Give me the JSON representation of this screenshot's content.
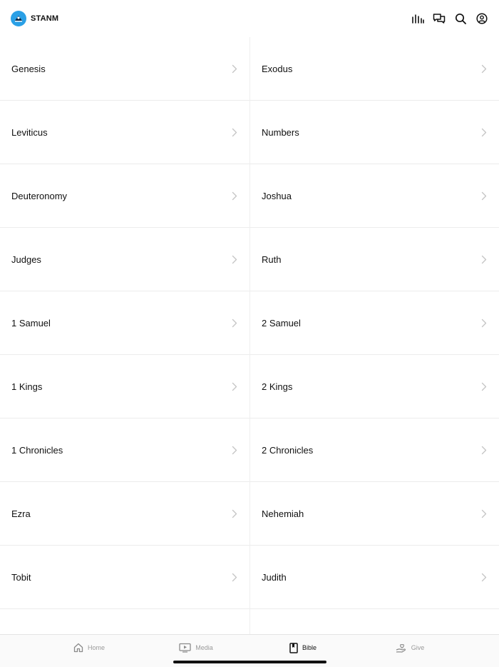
{
  "header": {
    "brand_name": "STANM",
    "actions": [
      {
        "name": "stats-icon"
      },
      {
        "name": "chat-icon"
      },
      {
        "name": "search-icon"
      },
      {
        "name": "profile-icon"
      }
    ]
  },
  "books": [
    [
      "Genesis",
      "Exodus"
    ],
    [
      "Leviticus",
      "Numbers"
    ],
    [
      "Deuteronomy",
      "Joshua"
    ],
    [
      "Judges",
      "Ruth"
    ],
    [
      "1 Samuel",
      "2 Samuel"
    ],
    [
      "1 Kings",
      "2 Kings"
    ],
    [
      "1 Chronicles",
      "2 Chronicles"
    ],
    [
      "Ezra",
      "Nehemiah"
    ],
    [
      "Tobit",
      "Judith"
    ],
    [
      "",
      ""
    ]
  ],
  "tabbar": {
    "tabs": [
      {
        "label": "Home",
        "icon": "home-icon",
        "active": false
      },
      {
        "label": "Media",
        "icon": "media-icon",
        "active": false
      },
      {
        "label": "Bible",
        "icon": "bible-icon",
        "active": true
      },
      {
        "label": "Give",
        "icon": "give-icon",
        "active": false
      }
    ]
  },
  "colors": {
    "accent_logo": "#2aa0e6",
    "text": "#111111",
    "inactive_tab": "#9a9a9a",
    "divider": "#ececec"
  }
}
